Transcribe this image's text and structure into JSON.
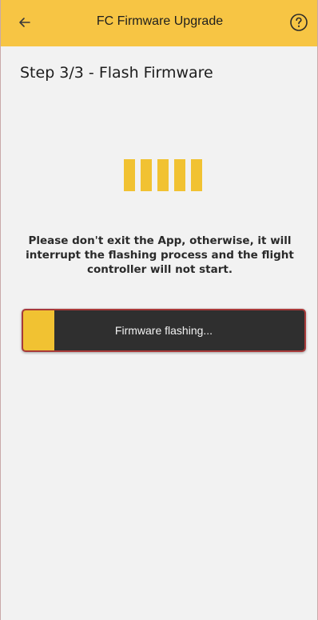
{
  "header": {
    "title": "FC Firmware Upgrade",
    "back_icon": "back-arrow-icon",
    "help_icon": "help-icon"
  },
  "step": {
    "title": "Step 3/3 - Flash Firmware"
  },
  "loader": {
    "bars": 5
  },
  "warning": {
    "text": "Please don't exit the App, otherwise, it will interrupt the flashing process and the flight controller will not start."
  },
  "progress": {
    "label": "Firmware flashing...",
    "value": 0.11
  },
  "colors": {
    "accent": "#f7c544",
    "progress_bg": "#2f2f2f",
    "progress_border": "#a83a3a"
  }
}
